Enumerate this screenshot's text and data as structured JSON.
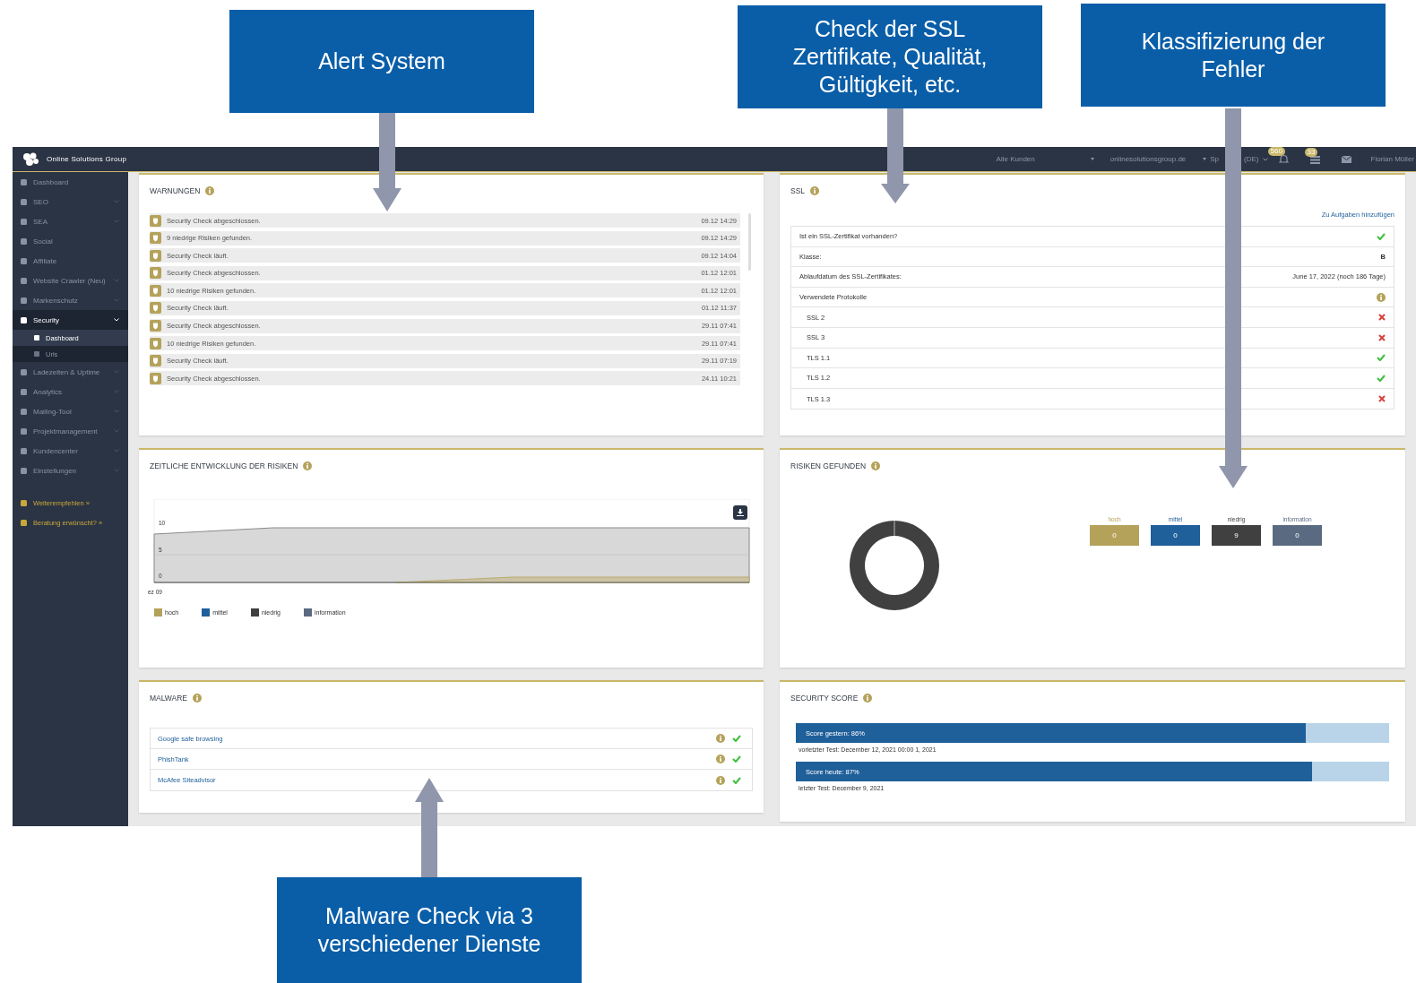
{
  "callouts": [
    {
      "lines": [
        "Alert System"
      ]
    },
    {
      "lines": [
        "Check der SSL",
        "Zertifikate, Qualität,",
        "Gültigkeit, etc."
      ]
    },
    {
      "lines": [
        "Klassifizierung der",
        "Fehler"
      ]
    },
    {
      "lines": [
        "Malware Check via 3",
        "verschiedener Dienste"
      ]
    }
  ],
  "topbar": {
    "brand": "Online Solutions Group",
    "customer": "Alle Kunden",
    "domain": "onlinesolutionsgroup.de",
    "language_parts": [
      "Sp",
      "(DE)"
    ],
    "notifications_badge": "560",
    "tasks_badge": "33",
    "user": "Florian Müller"
  },
  "sidebar": {
    "items": [
      {
        "label": "Dashboard",
        "expandable": false,
        "expanded": false
      },
      {
        "label": "SEO",
        "expandable": true,
        "expanded": false
      },
      {
        "label": "SEA",
        "expandable": true,
        "expanded": false
      },
      {
        "label": "Social",
        "expandable": false,
        "expanded": false
      },
      {
        "label": "Affiliate",
        "expandable": false,
        "expanded": false
      },
      {
        "label": "Website Crawler (Neu)",
        "expandable": true,
        "expanded": false
      },
      {
        "label": "Markenschutz",
        "expandable": true,
        "expanded": false
      },
      {
        "label": "Security",
        "expandable": true,
        "expanded": true,
        "children": [
          {
            "label": "Dashboard",
            "selected": true
          },
          {
            "label": "Urls",
            "selected": false
          }
        ]
      },
      {
        "label": "Ladezeiten & Uptime",
        "expandable": true,
        "expanded": false
      },
      {
        "label": "Analytics",
        "expandable": true,
        "expanded": false
      },
      {
        "label": "Mailing-Tool",
        "expandable": true,
        "expanded": false
      },
      {
        "label": "Projektmanagement",
        "expandable": true,
        "expanded": false
      },
      {
        "label": "Kundencenter",
        "expandable": true,
        "expanded": false
      },
      {
        "label": "Einstellungen",
        "expandable": true,
        "expanded": false
      }
    ],
    "links": [
      "Weiterempfehlen »",
      "Beratung erwünscht? »"
    ]
  },
  "warnings": {
    "title": "WARNUNGEN",
    "items": [
      {
        "text": "Security Check abgeschlossen.",
        "time": "09.12 14:29"
      },
      {
        "text": "9 niedrige Risiken gefunden.",
        "time": "09.12 14:29"
      },
      {
        "text": "Security Check läuft.",
        "time": "09.12 14:04"
      },
      {
        "text": "Security Check abgeschlossen.",
        "time": "01.12 12:01"
      },
      {
        "text": "10 niedrige Risiken gefunden.",
        "time": "01.12 12:01"
      },
      {
        "text": "Security Check läuft.",
        "time": "01.12 11:37"
      },
      {
        "text": "Security Check abgeschlossen.",
        "time": "29.11 07:41"
      },
      {
        "text": "10 niedrige Risiken gefunden.",
        "time": "29.11 07:41"
      },
      {
        "text": "Security Check läuft.",
        "time": "29.11 07:19"
      },
      {
        "text": "Security Check abgeschlossen.",
        "time": "24.11 10:21"
      }
    ]
  },
  "ssl": {
    "title": "SSL",
    "link": "Zu Aufgaben hinzufügen",
    "rows": [
      {
        "label": "Ist ein SSL-Zertifikat vorhanden?",
        "kind": "status",
        "ok": true
      },
      {
        "label": "Klasse:",
        "kind": "text",
        "value": "B"
      },
      {
        "label": "Ablaufdatum des SSL-Zertifikates:",
        "kind": "text",
        "value": "June 17, 2022 (noch 186 Tage)"
      },
      {
        "label": "Verwendete Protokolle",
        "kind": "info",
        "children": [
          {
            "label": "SSL 2",
            "ok": false
          },
          {
            "label": "SSL 3",
            "ok": false
          },
          {
            "label": "TLS 1.1",
            "ok": true
          },
          {
            "label": "TLS 1.2",
            "ok": true
          },
          {
            "label": "TLS 1.3",
            "ok": false
          }
        ]
      }
    ]
  },
  "risk_chart": {
    "title": "ZEITLICHE ENTWICKLUNG DER RISIKEN",
    "y_labels": [
      "10",
      "5",
      "0"
    ],
    "first_date_label": "ez 09",
    "legend": [
      {
        "label": "hoch",
        "color": "#b5a25a"
      },
      {
        "label": "mittel",
        "color": "#1f5f9a"
      },
      {
        "label": "niedrig",
        "color": "#404040"
      },
      {
        "label": "information",
        "color": "#5a6a80"
      }
    ]
  },
  "risks": {
    "title": "RISIKEN GEFUNDEN",
    "counts": [
      {
        "label": "hoch",
        "value": "0",
        "color": "#b5a25a"
      },
      {
        "label": "mittel",
        "value": "0",
        "color": "#1f5f9a"
      },
      {
        "label": "niedrig",
        "value": "9",
        "color": "#404040"
      },
      {
        "label": "information",
        "value": "0",
        "color": "#5a6a80"
      }
    ]
  },
  "malware": {
    "title": "MALWARE",
    "services": [
      {
        "name": "Google safe browsing",
        "ok": true
      },
      {
        "name": "PhishTank",
        "ok": true
      },
      {
        "name": "McAfee Siteadvisor",
        "ok": true
      }
    ]
  },
  "score": {
    "title": "SECURITY SCORE",
    "items": [
      {
        "label": "Score gestern: 86%",
        "level": 0.86,
        "note": "vorletzter Test: December 12, 2021 00:00 1, 2021"
      },
      {
        "label": "Score heute: 87%",
        "level": 0.87,
        "note": "letzter Test: December 9, 2021"
      }
    ]
  }
}
